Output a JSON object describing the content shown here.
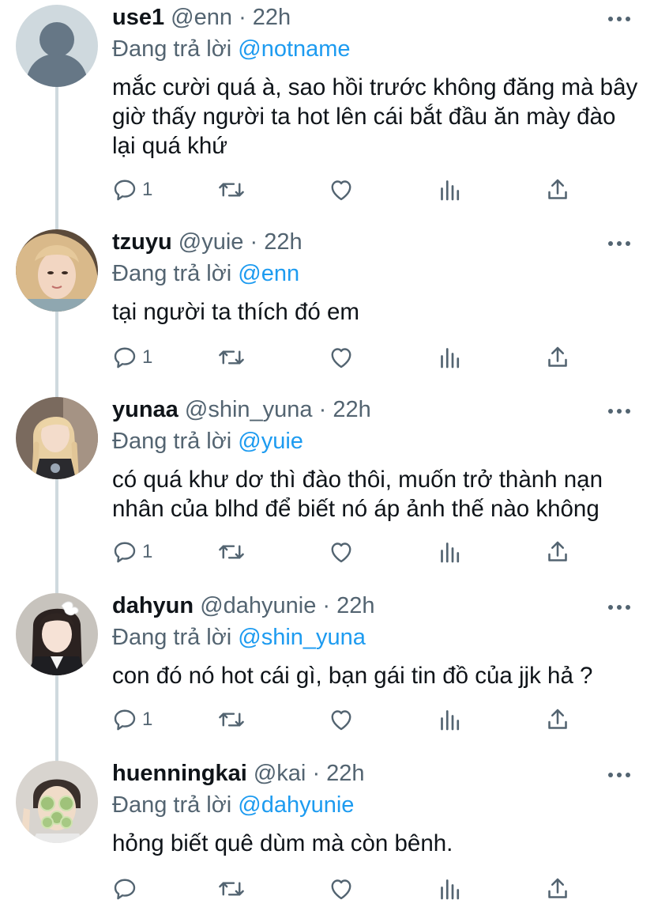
{
  "reply_prefix": "Đang trả lời",
  "tweets": [
    {
      "name": "use1",
      "handle": "@enn",
      "separator": "·",
      "time": "22h",
      "replying_to": "@notname",
      "text": "mắc cười quá à, sao hồi trước không đăng mà bây giờ thấy người ta hot lên cái bắt đầu ăn mày đào lại quá khứ",
      "reply_count": "1",
      "avatar": "default-avatar"
    },
    {
      "name": "tzuyu",
      "handle": "@yuie",
      "separator": "·",
      "time": "22h",
      "replying_to": "@enn",
      "text": "tại người ta thích đó em",
      "reply_count": "1",
      "avatar": "photo-blonde"
    },
    {
      "name": "yunaa",
      "handle": "@shin_yuna",
      "separator": "·",
      "time": "22h",
      "replying_to": "@yuie",
      "text": "có quá khư dơ thì đào thôi, muốn trở thành nạn nhân của blhd để biết nó áp ảnh thế nào không",
      "reply_count": "1",
      "avatar": "photo-braids"
    },
    {
      "name": "dahyun",
      "handle": "@dahyunie",
      "separator": "·",
      "time": "22h",
      "replying_to": "@shin_yuna",
      "text": "con đó nó hot cái gì, bạn gái tin đồ của jjk hả ?",
      "reply_count": "1",
      "avatar": "photo-ribbon"
    },
    {
      "name": "huenningkai",
      "handle": "@kai",
      "separator": "·",
      "time": "22h",
      "replying_to": "@dahyunie",
      "text": "hỏng biết quê dùm mà còn bênh.",
      "reply_count": "",
      "avatar": "photo-cucumber"
    }
  ],
  "icons": {
    "more": "more-dots-icon",
    "reply": "reply-bubble-icon",
    "retweet": "retweet-icon",
    "like": "heart-icon",
    "views": "views-bar-chart-icon",
    "share": "share-upload-icon"
  },
  "colors": {
    "text": "#0f1419",
    "secondary": "#536471",
    "accent": "#1d9bf0",
    "thread_line": "#cfd9de"
  }
}
